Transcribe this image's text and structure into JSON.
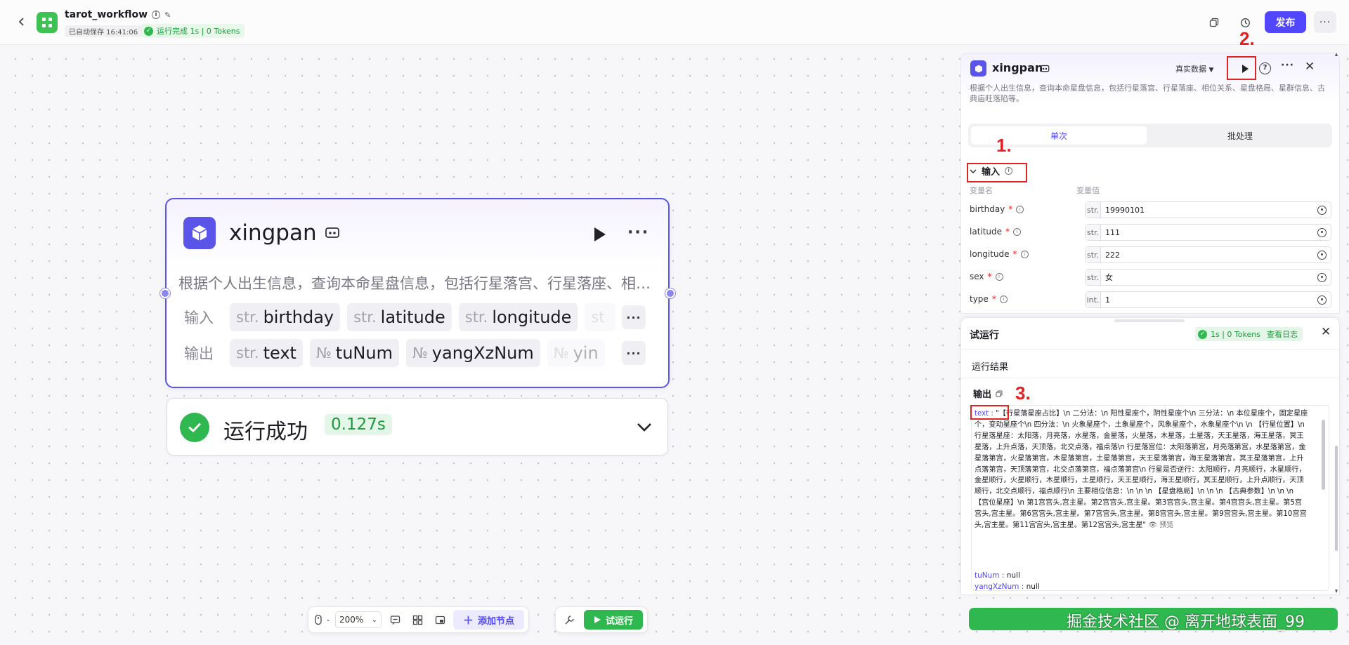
{
  "topbar": {
    "title": "tarot_workflow",
    "autosave": "已自动保存 16:41:06",
    "run_status": "运行完成 1s | 0 Tokens",
    "publish_label": "发布"
  },
  "node": {
    "title": "xingpan",
    "description": "根据个人出生信息，查询本命星盘信息，包括行星落宫、行星落座、相位关系、星盘格局、星群信息、古典庙旺落陷等。",
    "input_label": "输入",
    "output_label": "输出",
    "inputs": [
      {
        "type": "str.",
        "name": "birthday"
      },
      {
        "type": "str.",
        "name": "latitude"
      },
      {
        "type": "str.",
        "name": "longitude"
      },
      {
        "type": "st",
        "name": ""
      }
    ],
    "outputs": [
      {
        "type": "str.",
        "name": "text"
      },
      {
        "type": "№",
        "name": "tuNum"
      },
      {
        "type": "№",
        "name": "yangXzNum"
      },
      {
        "type": "№",
        "name": "yin"
      }
    ]
  },
  "result_card": {
    "status": "运行成功",
    "time": "0.127s"
  },
  "toolbar": {
    "zoom": "200%",
    "add_node": "添加节点",
    "trial_run": "试运行"
  },
  "panel": {
    "title": "xingpan",
    "data_mode": "真实数据",
    "description": "根据个人出生信息，查询本命星盘信息，包括行星落宫、行星落座、相位关系、星盘格局、星群信息、古典庙旺落陷等。",
    "tab_single": "单次",
    "tab_batch": "批处理",
    "section_input": "输入",
    "col_name": "变量名",
    "col_value": "变量值",
    "fields": [
      {
        "name": "birthday",
        "type": "str.",
        "value": "19990101"
      },
      {
        "name": "latitude",
        "type": "str.",
        "value": "111"
      },
      {
        "name": "longitude",
        "type": "str.",
        "value": "222"
      },
      {
        "name": "sex",
        "type": "str.",
        "value": "女"
      },
      {
        "name": "type",
        "type": "int.",
        "value": "1"
      }
    ],
    "annotations": [
      "1.",
      "2.",
      "3."
    ]
  },
  "trial": {
    "title": "试运行",
    "badge": "1s | 0 Tokens",
    "view_log": "查看日志",
    "run_result": "运行结果",
    "output_label": "输出",
    "text_key": "text : ",
    "text_value": "\"【行星落星座占比】\\n       二分法：\\n       阳性星座个，阴性星座个\\n       三分法：\\n       本位星座个，固定星座个，变动星座个\\n       四分法：\\n       火象星座个，土象星座个，风象星座个，水象星座个\\n       \\n       【行星位置】\\n       行星落星座：太阳落，月亮落，水星落，金星落，火星落，木星落，土星落，天王星落，海王星落，冥王星落，上升点落，天顶落，北交点落，福点落\\n       行星落宫位：太阳落第宫，月亮落第宫，水星落第宫，金星落第宫，火星落第宫，木星落第宫，土星落第宫，天王星落第宫，海王星落第宫，冥王星落第宫，上升点落第宫，天顶落第宫，北交点落第宫，福点落第宫\\n       行星是否逆行：太阳顺行，月亮顺行，水星顺行，金星顺行，火星顺行，木星顺行，土星顺行，天王星顺行，海王星顺行，冥王星顺行，上升点顺行，天顶顺行，北交点顺行，福点顺行\\n       主要相位信息：\\n       \\n       \\n       【星盘格局】\\n       \\n       \\n       【古典参数】\\n       \\n  \\n       【宫位星座】\\n       第1宫宫头,宫主星。第2宫宫头,宫主星。第3宫宫头,宫主星。第4宫宫头,宫主星。第5宫宫头,宫主星。第6宫宫头,宫主星。第7宫宫头,宫主星。第8宫宫头,宫主星。第9宫宫头,宫主星。第10宫宫头,宫主星。第11宫宫头,宫主星。第12宫宫头,宫主星\"",
    "preview": "预览",
    "tu_key": "tuNum : ",
    "tu_value": "null",
    "yang_key": "yangXzNum : ",
    "yang_value": "null"
  },
  "watermark": "掘金技术社区 @ 离开地球表面_99"
}
